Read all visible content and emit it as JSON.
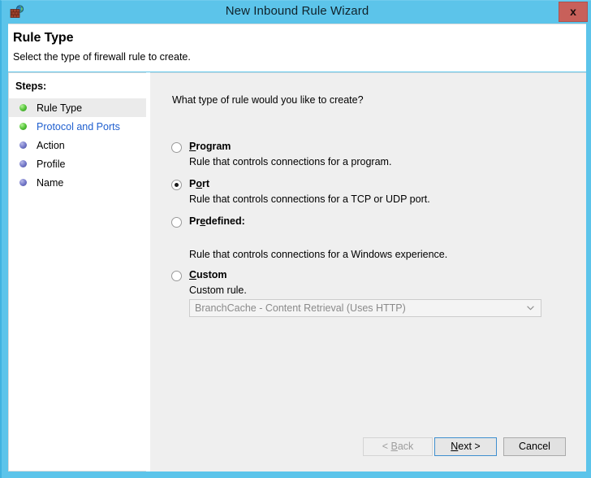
{
  "window": {
    "title": "New Inbound Rule Wizard",
    "icon": "firewall-globe-icon",
    "close_label": "x",
    "chrome_color": "#5cc4ea",
    "close_color": "#c8605a"
  },
  "header": {
    "title": "Rule Type",
    "subtitle": "Select the type of firewall rule to create."
  },
  "sidebar": {
    "label": "Steps:",
    "items": [
      {
        "label": "Rule Type",
        "state": "current",
        "bullet": "green-bullet-icon",
        "link": false
      },
      {
        "label": "Protocol and Ports",
        "state": "done",
        "bullet": "green-bullet-icon",
        "link": true
      },
      {
        "label": "Action",
        "state": "pending",
        "bullet": "purple-bullet-icon",
        "link": false
      },
      {
        "label": "Profile",
        "state": "pending",
        "bullet": "purple-bullet-icon",
        "link": false
      },
      {
        "label": "Name",
        "state": "pending",
        "bullet": "purple-bullet-icon",
        "link": false
      }
    ]
  },
  "main": {
    "question": "What type of rule would you like to create?",
    "options": [
      {
        "label_pre": "",
        "label_key": "P",
        "label_post": "rogram",
        "description": "Rule that controls connections for a program.",
        "selected": false
      },
      {
        "label_pre": "P",
        "label_key": "o",
        "label_post": "rt",
        "description": "Rule that controls connections for a TCP or UDP port.",
        "selected": true
      },
      {
        "label_pre": "Pr",
        "label_key": "e",
        "label_post": "defined:",
        "description": "Rule that controls connections for a Windows experience.",
        "selected": false
      },
      {
        "label_pre": "",
        "label_key": "C",
        "label_post": "ustom",
        "description": "Custom rule.",
        "selected": false
      }
    ],
    "predefined_combo": {
      "value": "BranchCache - Content Retrieval (Uses HTTP)",
      "enabled": false,
      "arrow": "chevron-down-icon"
    }
  },
  "footer": {
    "back": {
      "pre": "< ",
      "key": "B",
      "post": "ack",
      "enabled": false
    },
    "next": {
      "pre": "",
      "key": "N",
      "post": "ext >",
      "enabled": true,
      "focused": true
    },
    "cancel": {
      "pre": "",
      "key": "",
      "post": "Cancel",
      "enabled": true
    }
  }
}
